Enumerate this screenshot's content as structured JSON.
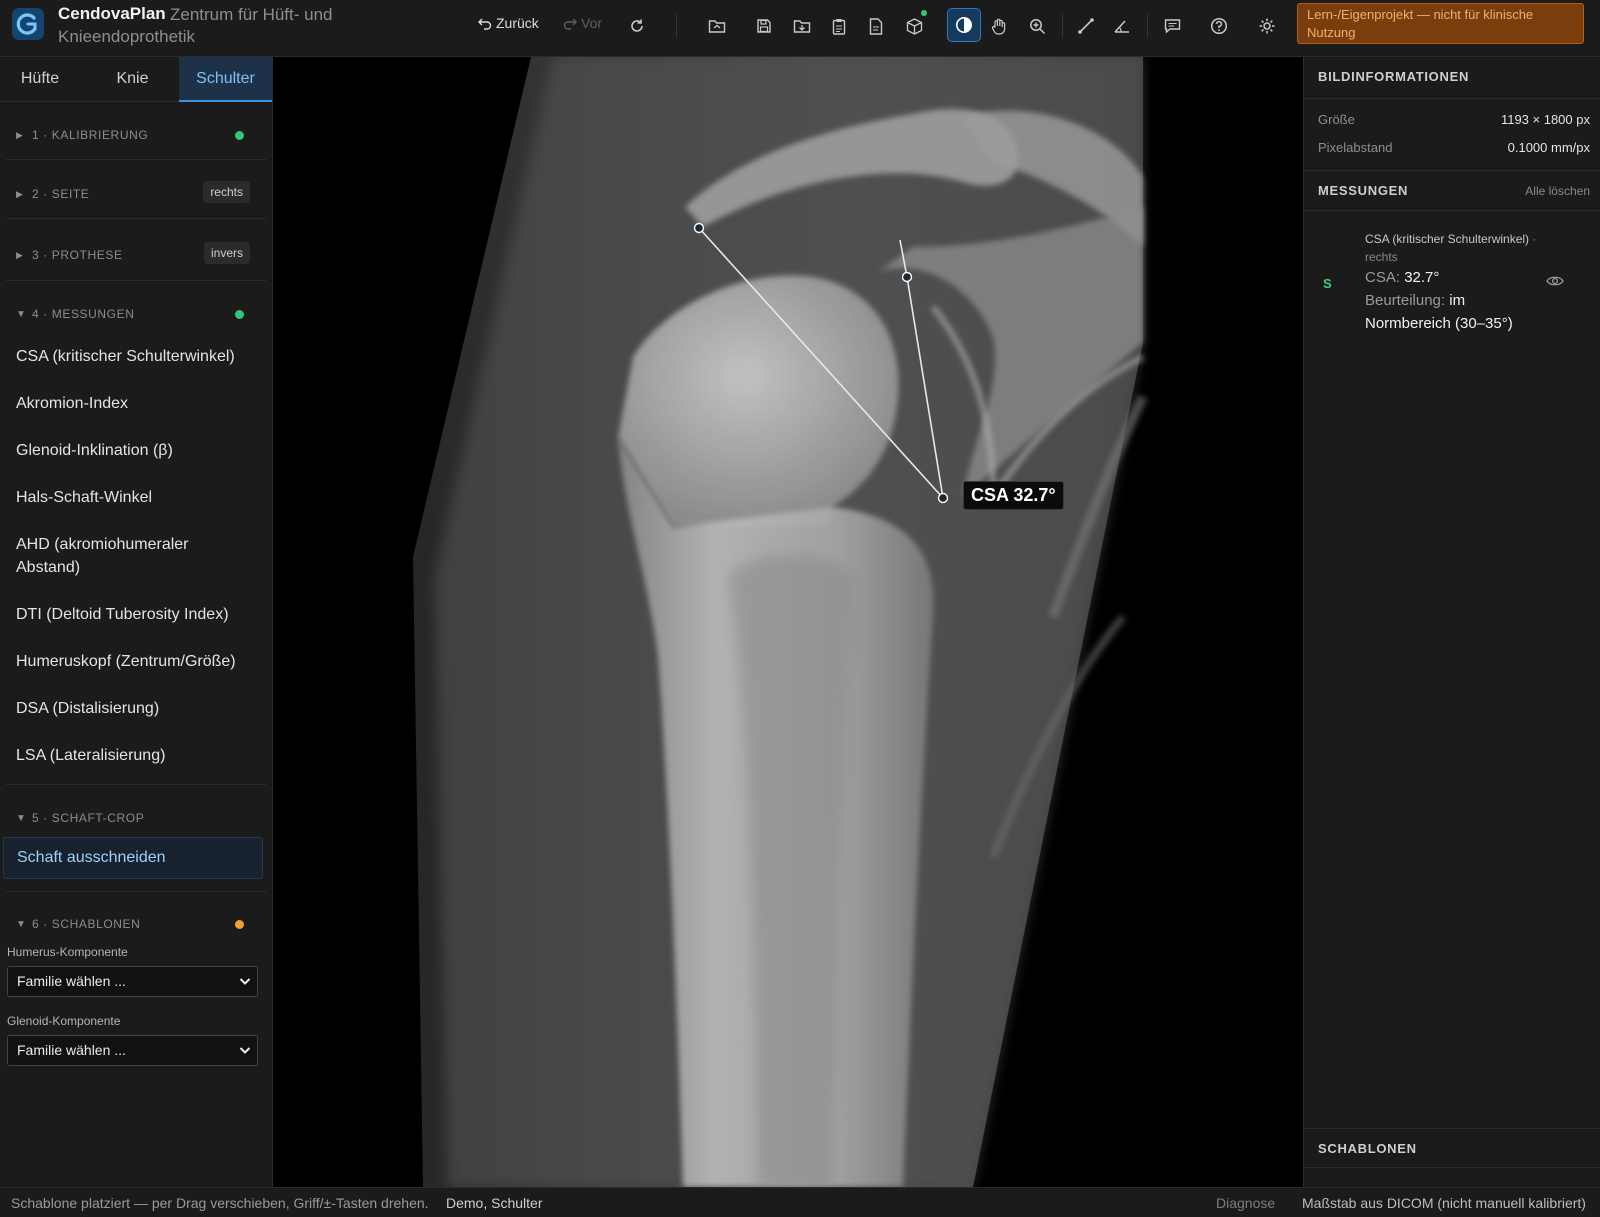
{
  "app": {
    "name": "CendovaPlan",
    "subtitle": "Zentrum für Hüft- und Knieendoprothetik"
  },
  "toolbar": {
    "back_label": "Zurück",
    "forward_label": "Vor",
    "icons": [
      "refresh-icon",
      "open-folder-icon",
      "save-icon",
      "load-icon",
      "clipboard-icon",
      "report-icon",
      "3d-box-icon",
      "contrast-icon",
      "pan-hand-icon",
      "zoom-icon",
      "line-measure-icon",
      "angle-measure-icon",
      "comment-icon",
      "help-icon",
      "settings-icon"
    ],
    "active_tool": "contrast-icon",
    "warning": "Lern-/Eigenprojekt — nicht für klinische Nutzung"
  },
  "sidebar": {
    "tabs": [
      {
        "label": "Hüfte",
        "active": false
      },
      {
        "label": "Knie",
        "active": false
      },
      {
        "label": "Schulter",
        "active": true
      }
    ],
    "sections": [
      {
        "title": "1 · KALIBRIERUNG",
        "expanded": false,
        "status": "green"
      },
      {
        "title": "2 · SEITE",
        "expanded": false,
        "badge": "rechts"
      },
      {
        "title": "3 · PROTHESE",
        "expanded": false,
        "badge": "invers"
      },
      {
        "title": "4 · MESSUNGEN",
        "expanded": true,
        "status": "green"
      },
      {
        "title": "5 · SCHAFT-CROP",
        "expanded": true
      },
      {
        "title": "6 · SCHABLONEN",
        "expanded": true,
        "status": "orange"
      }
    ],
    "measurements": [
      "CSA (kritischer Schulterwinkel)",
      "Akromion-Index",
      "Glenoid-Inklination (β)",
      "Hals-Schaft-Winkel",
      "AHD (akromiohumeraler Abstand)",
      "DTI (Deltoid Tuberosity Index)",
      "Humeruskopf (Zentrum/Größe)",
      "DSA (Distalisierung)",
      "LSA (Lateralisierung)"
    ],
    "crop_button": "Schaft ausschneiden",
    "templates": {
      "humerus_label": "Humerus-Komponente",
      "humerus_value": "Familie wählen ...",
      "glenoid_label": "Glenoid-Komponente",
      "glenoid_value": "Familie wählen ..."
    }
  },
  "viewer": {
    "csa_label": "CSA 32.7°"
  },
  "right_panel": {
    "image_info_title": "BILDINFORMATIONEN",
    "size_key": "Größe",
    "size_value": "1193 × 1800 px",
    "spacing_key": "Pixelabstand",
    "spacing_value": "0.1000 mm/px",
    "measurements_title": "MESSUNGEN",
    "clear_all": "Alle löschen",
    "measurement": {
      "side_letter": "S",
      "title": "CSA (kritischer Schulterwinkel)",
      "side": "· rechts",
      "value_key": "CSA:",
      "value": "32.7°",
      "assessment_key": "Beurteilung:",
      "assessment_value": "im Normbereich (30–35°)"
    },
    "templates_title": "SCHABLONEN"
  },
  "status_bar": {
    "message": "Schablone platziert — per Drag verschieben, Griff/±-Tasten drehen.",
    "case": "Demo, Schulter",
    "diagnosis": "Diagnose",
    "scale": "Maßstab aus DICOM (nicht manuell kalibriert)"
  },
  "colors": {
    "accent_blue": "#3c95e0",
    "status_green": "#34c77b",
    "status_orange": "#f0a030",
    "warning_bg": "#7a3d0d"
  }
}
